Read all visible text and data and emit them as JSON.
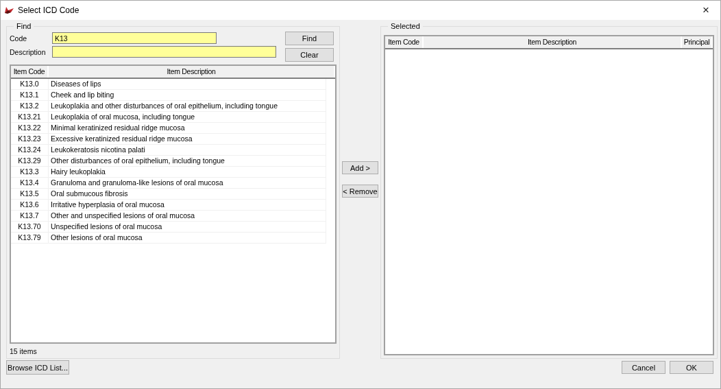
{
  "window": {
    "title": "Select ICD Code",
    "close": "×"
  },
  "find": {
    "title": "Find",
    "fields": [
      {
        "label": "Code",
        "value": "K13"
      },
      {
        "label": "Description"
      }
    ],
    "buttons": [
      "Find",
      "Clear"
    ],
    "results": {
      "columns": [
        "Item Code",
        "Item Description"
      ],
      "rows": [
        {
          "code": "K13.0",
          "description": "Diseases of lips"
        },
        {
          "code": "K13.1",
          "description": "Cheek and lip biting"
        },
        {
          "code": "K13.2",
          "description": "Leukoplakia and other disturbances of oral epithelium, including tongue"
        },
        {
          "code": "K13.21",
          "description": "Leukoplakia of oral mucosa, including tongue"
        },
        {
          "code": "K13.22",
          "description": "Minimal keratinized residual ridge mucosa"
        },
        {
          "code": "K13.23",
          "description": "Excessive keratinized residual ridge mucosa"
        },
        {
          "code": "K13.24",
          "description": "Leukokeratosis nicotina palati"
        },
        {
          "code": "K13.29",
          "description": "Other disturbances of oral epithelium, including tongue"
        },
        {
          "code": "K13.3",
          "description": "Hairy leukoplakia"
        },
        {
          "code": "K13.4",
          "description": "Granuloma and granuloma-like lesions of oral mucosa"
        },
        {
          "code": "K13.5",
          "description": "Oral submucous fibrosis"
        },
        {
          "code": "K13.6",
          "description": "Irritative hyperplasia of oral mucosa"
        },
        {
          "code": "K13.7",
          "description": "Other and unspecified lesions of oral mucosa"
        },
        {
          "code": "K13.70",
          "description": "Unspecified lesions of oral mucosa"
        },
        {
          "code": "K13.79",
          "description": "Other lesions of oral mucosa"
        }
      ]
    },
    "status": "15 items"
  },
  "transfer_buttons": [
    "Add >",
    "< Remove"
  ],
  "selected": {
    "title": "Selected",
    "columns": [
      "Item Code",
      "Item Description",
      "Principal"
    ]
  },
  "footer": {
    "left_buttons": [
      "Browse ICD List..."
    ],
    "right_buttons": [
      "Cancel",
      "OK"
    ]
  }
}
